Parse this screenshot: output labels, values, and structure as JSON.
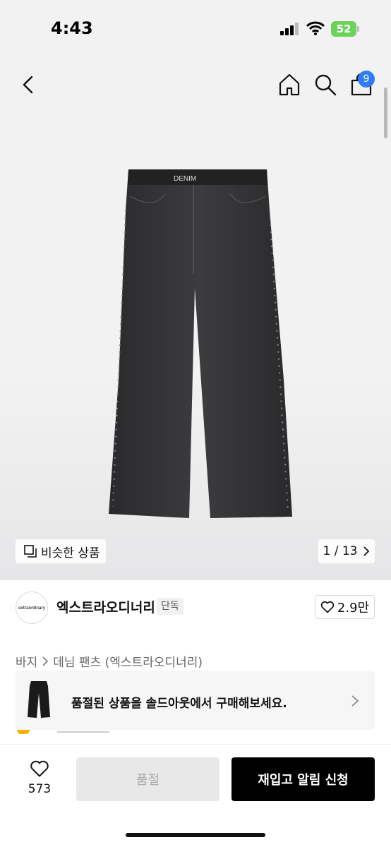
{
  "status": {
    "time": "4:43",
    "battery": "52"
  },
  "nav": {
    "cart_count": "9",
    "icons": [
      "back-icon",
      "home-icon",
      "search-icon",
      "cart-icon"
    ]
  },
  "gallery": {
    "similar_label": "비슷한 상품",
    "pager": "1 / 13"
  },
  "brand": {
    "logo_text": "extraordinary",
    "name": "엑스트라오디너리",
    "tag": "단독",
    "likes": "2.9만"
  },
  "breadcrumb": {
    "category": "바지",
    "subcategory": "데님 팬츠 (엑스트라오디너리)"
  },
  "soldout_banner": {
    "text": "품절된 상품을 솔드아웃에서 구매해보세요."
  },
  "bottom": {
    "wish_count": "573",
    "soldout_label": "품절",
    "restock_label": "재입고 알림 신청"
  },
  "colors": {
    "accent": "#2f7cf6",
    "primary_button": "#000000",
    "battery": "#6dd25b"
  }
}
